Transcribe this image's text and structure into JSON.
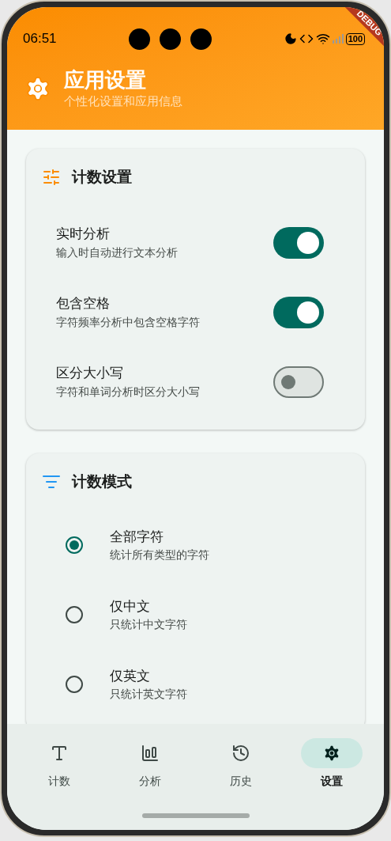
{
  "status_bar": {
    "time": "06:51",
    "battery": "100"
  },
  "debug_banner": "DEBUG",
  "header": {
    "title": "应用设置",
    "subtitle": "个性化设置和应用信息"
  },
  "count_settings": {
    "title": "计数设置",
    "items": [
      {
        "label": "实时分析",
        "description": "输入时自动进行文本分析",
        "on": true
      },
      {
        "label": "包含空格",
        "description": "字符频率分析中包含空格字符",
        "on": true
      },
      {
        "label": "区分大小写",
        "description": "字符和单词分析时区分大小写",
        "on": false
      }
    ]
  },
  "count_mode": {
    "title": "计数模式",
    "options": [
      {
        "label": "全部字符",
        "description": "统计所有类型的字符",
        "selected": true
      },
      {
        "label": "仅中文",
        "description": "只统计中文字符",
        "selected": false
      },
      {
        "label": "仅英文",
        "description": "只统计英文字符",
        "selected": false
      }
    ]
  },
  "bottom_nav": [
    {
      "label": "计数",
      "selected": false
    },
    {
      "label": "分析",
      "selected": false
    },
    {
      "label": "历史",
      "selected": false
    },
    {
      "label": "设置",
      "selected": true
    }
  ]
}
